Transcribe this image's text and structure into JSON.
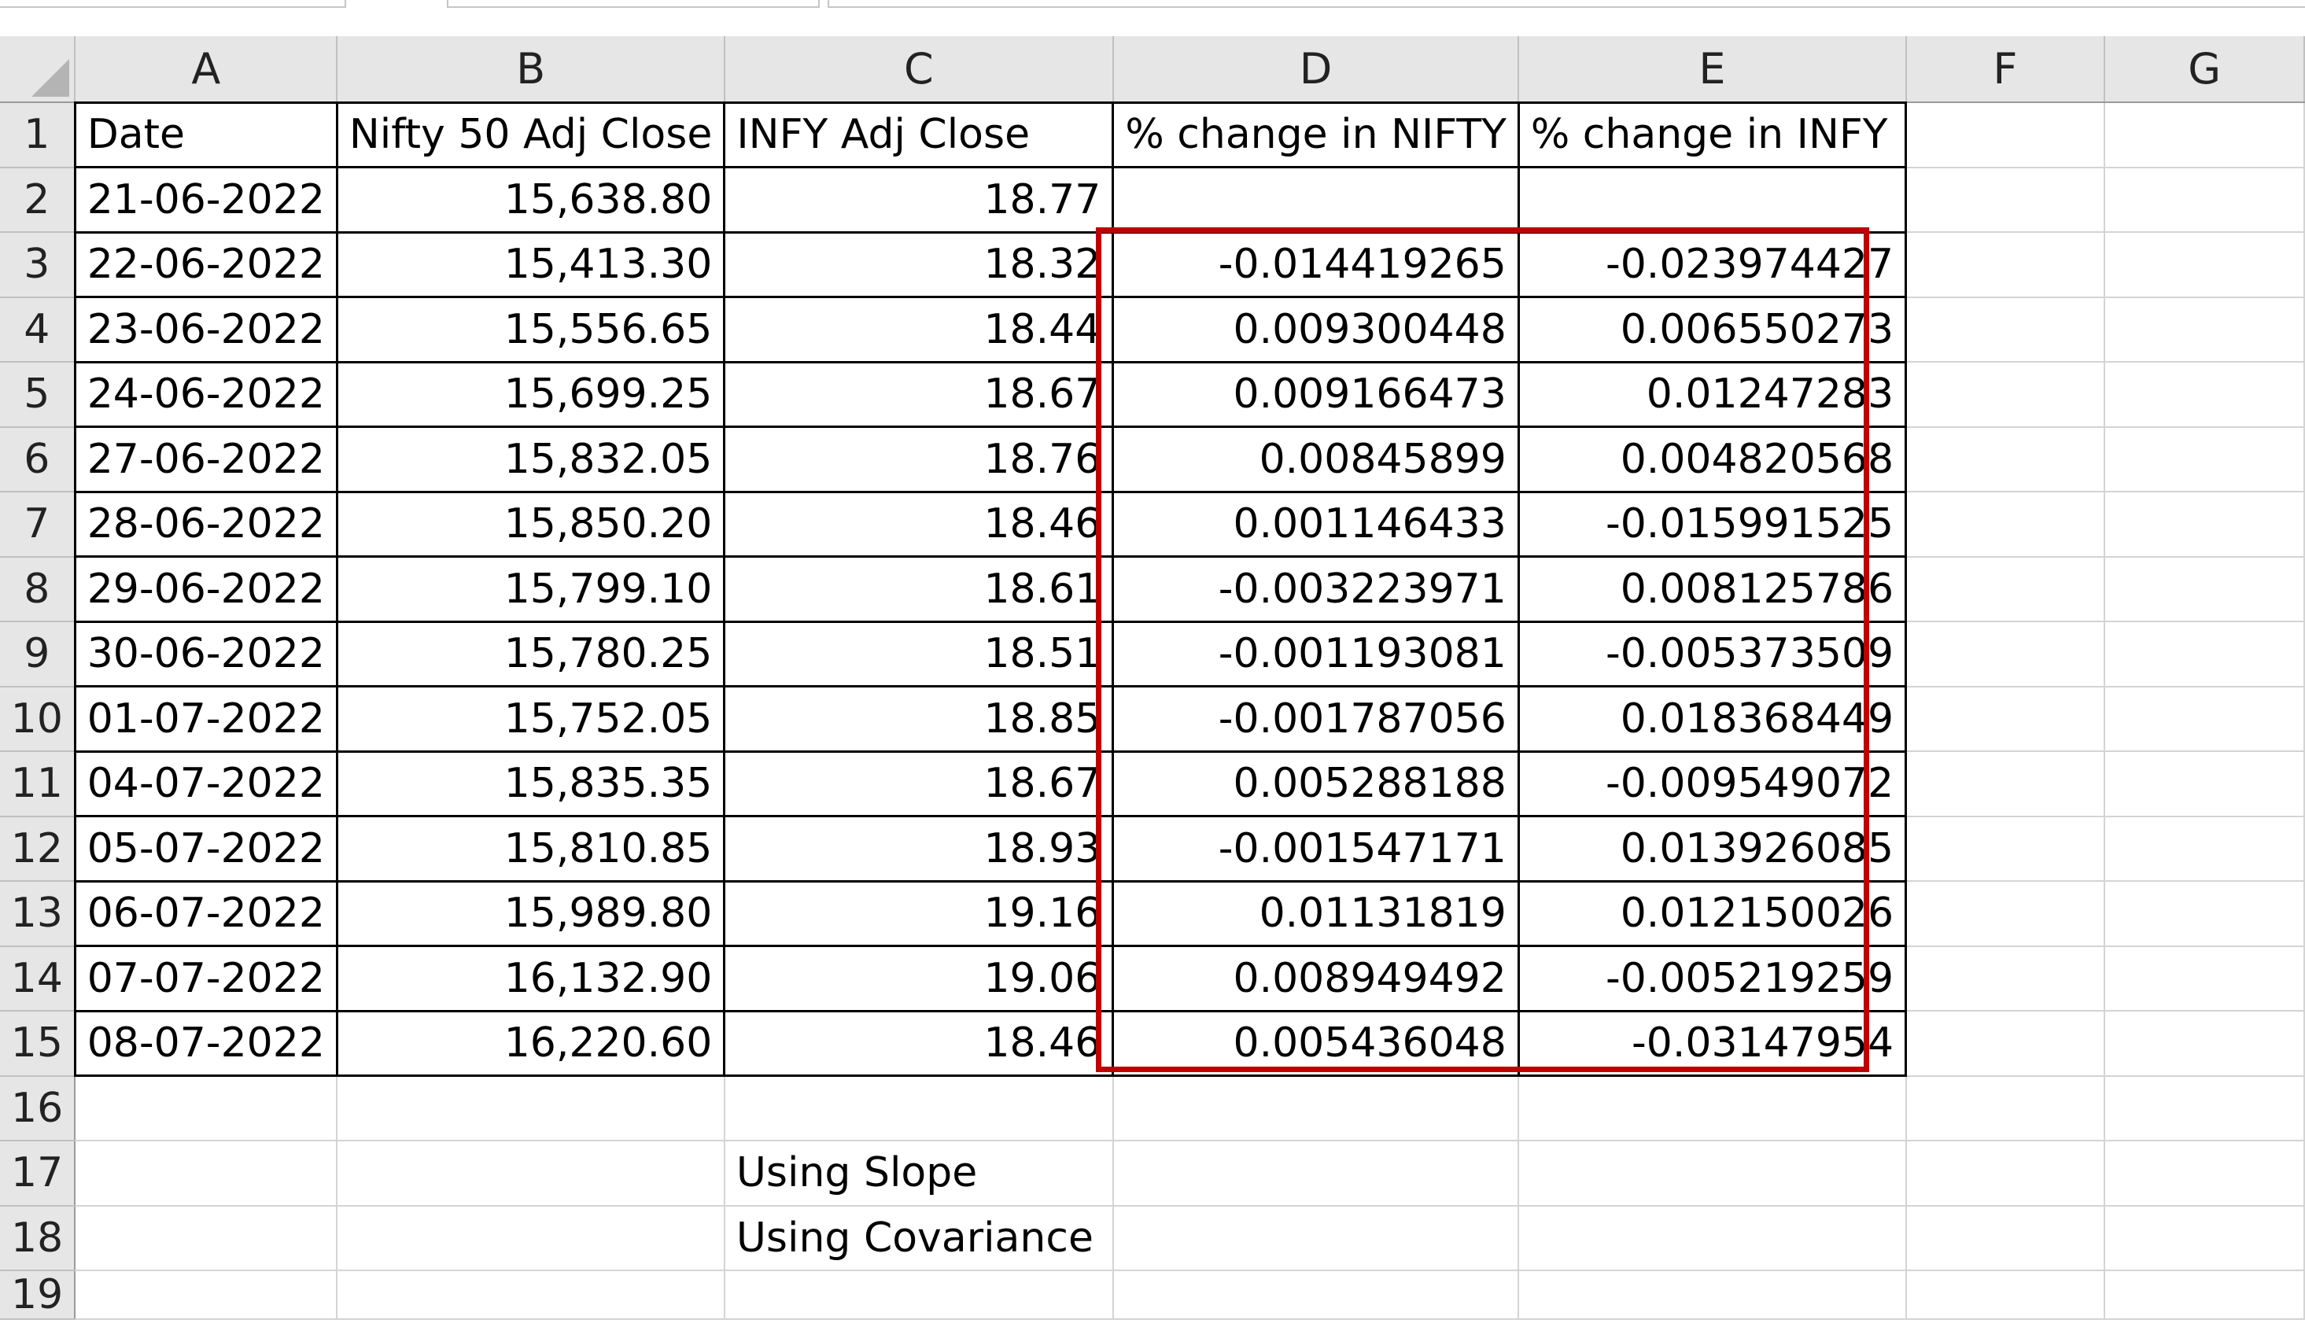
{
  "columns": [
    "A",
    "B",
    "C",
    "D",
    "E",
    "F",
    "G"
  ],
  "rows": [
    {
      "n": "1",
      "cells": [
        "Date",
        "Nifty 50 Adj Close",
        "INFY Adj Close",
        "% change in NIFTY",
        "% change in INFY",
        "",
        ""
      ]
    },
    {
      "n": "2",
      "cells": [
        "21-06-2022",
        "15,638.80",
        "18.77",
        "",
        "",
        "",
        ""
      ]
    },
    {
      "n": "3",
      "cells": [
        "22-06-2022",
        "15,413.30",
        "18.32",
        "-0.014419265",
        "-0.023974427",
        "",
        ""
      ]
    },
    {
      "n": "4",
      "cells": [
        "23-06-2022",
        "15,556.65",
        "18.44",
        "0.009300448",
        "0.006550273",
        "",
        ""
      ]
    },
    {
      "n": "5",
      "cells": [
        "24-06-2022",
        "15,699.25",
        "18.67",
        "0.009166473",
        "0.01247283",
        "",
        ""
      ]
    },
    {
      "n": "6",
      "cells": [
        "27-06-2022",
        "15,832.05",
        "18.76",
        "0.00845899",
        "0.004820568",
        "",
        ""
      ]
    },
    {
      "n": "7",
      "cells": [
        "28-06-2022",
        "15,850.20",
        "18.46",
        "0.001146433",
        "-0.015991525",
        "",
        ""
      ]
    },
    {
      "n": "8",
      "cells": [
        "29-06-2022",
        "15,799.10",
        "18.61",
        "-0.003223971",
        "0.008125786",
        "",
        ""
      ]
    },
    {
      "n": "9",
      "cells": [
        "30-06-2022",
        "15,780.25",
        "18.51",
        "-0.001193081",
        "-0.005373509",
        "",
        ""
      ]
    },
    {
      "n": "10",
      "cells": [
        "01-07-2022",
        "15,752.05",
        "18.85",
        "-0.001787056",
        "0.018368449",
        "",
        ""
      ]
    },
    {
      "n": "11",
      "cells": [
        "04-07-2022",
        "15,835.35",
        "18.67",
        "0.005288188",
        "-0.009549072",
        "",
        ""
      ]
    },
    {
      "n": "12",
      "cells": [
        "05-07-2022",
        "15,810.85",
        "18.93",
        "-0.001547171",
        "0.013926085",
        "",
        ""
      ]
    },
    {
      "n": "13",
      "cells": [
        "06-07-2022",
        "15,989.80",
        "19.16",
        "0.01131819",
        "0.012150026",
        "",
        ""
      ]
    },
    {
      "n": "14",
      "cells": [
        "07-07-2022",
        "16,132.90",
        "19.06",
        "0.008949492",
        "-0.005219259",
        "",
        ""
      ]
    },
    {
      "n": "15",
      "cells": [
        "08-07-2022",
        "16,220.60",
        "18.46",
        "0.005436048",
        "-0.03147954",
        "",
        ""
      ]
    },
    {
      "n": "16",
      "cells": [
        "",
        "",
        "",
        "",
        "",
        "",
        ""
      ]
    },
    {
      "n": "17",
      "cells": [
        "",
        "",
        "Using Slope",
        "",
        "",
        "",
        ""
      ]
    },
    {
      "n": "18",
      "cells": [
        "",
        "",
        "Using Covariance",
        "",
        "",
        "",
        ""
      ]
    },
    {
      "n": "19",
      "cells": [
        "",
        "",
        "",
        "",
        "",
        "",
        ""
      ]
    }
  ],
  "colors": {
    "highlight_border": "#c00000",
    "header_bg": "#e6e6e6",
    "gridline": "#d4d4d4"
  }
}
